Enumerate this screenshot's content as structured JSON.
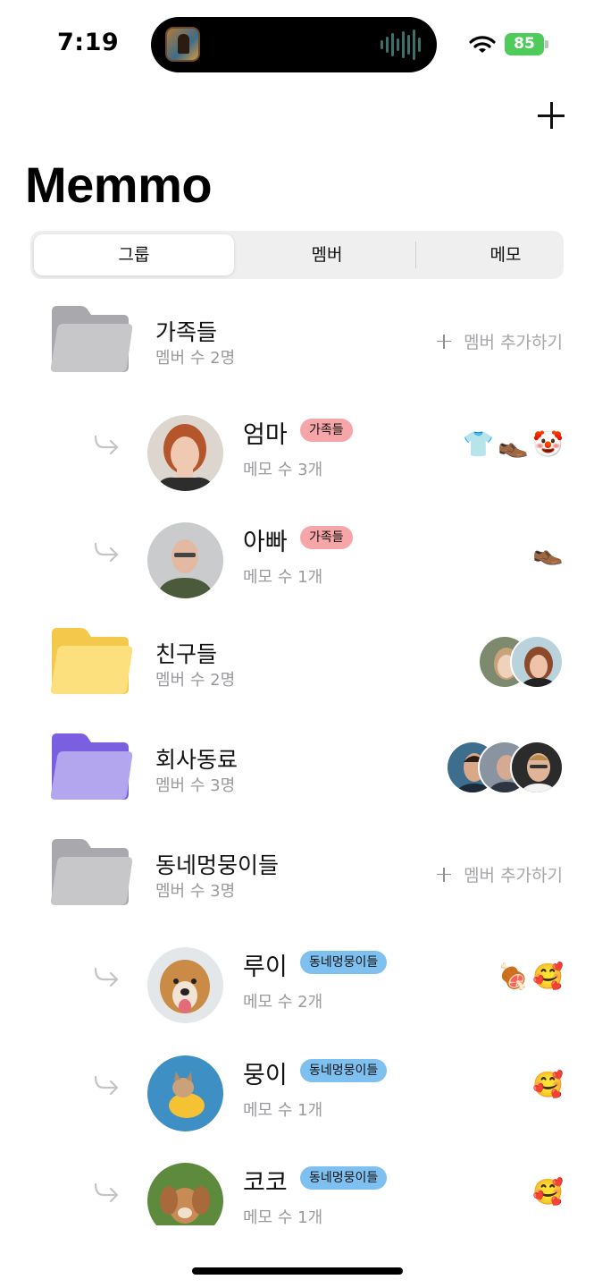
{
  "status": {
    "time": "7:19",
    "battery": "85"
  },
  "header": {
    "title": "Memmo"
  },
  "tabs": [
    {
      "label": "그룹"
    },
    {
      "label": "멤버"
    },
    {
      "label": "메모"
    }
  ],
  "groups": [
    {
      "name": "가족들",
      "count": "멤버 수 2명",
      "add_label": "멤버 추가하기",
      "color": "#c7c7c9"
    },
    {
      "name": "친구들",
      "count": "멤버 수 2명",
      "color": "#f9d96b"
    },
    {
      "name": "회사동료",
      "count": "멤버 수 3명",
      "color": "#a48ee6"
    },
    {
      "name": "동네멍뭉이들",
      "count": "멤버 수 3명",
      "add_label": "멤버 추가하기",
      "color": "#c7c7c9"
    }
  ],
  "members": [
    {
      "name": "엄마",
      "badge": "가족들",
      "memo": "메모 수 3개",
      "emojis": [
        "👕",
        "👞",
        "🤡"
      ]
    },
    {
      "name": "아빠",
      "badge": "가족들",
      "memo": "메모 수 1개",
      "emojis": [
        "👞"
      ]
    },
    {
      "name": "루이",
      "badge": "동네멍뭉이들",
      "memo": "메모 수 2개",
      "emojis": [
        "🍖",
        "🥰"
      ]
    },
    {
      "name": "뭉이",
      "badge": "동네멍뭉이들",
      "memo": "메모 수 1개",
      "emojis": [
        "🥰"
      ]
    },
    {
      "name": "코코",
      "badge": "동네멍뭉이들",
      "memo": "메모 수 1개",
      "emojis": [
        "🥰"
      ]
    }
  ]
}
